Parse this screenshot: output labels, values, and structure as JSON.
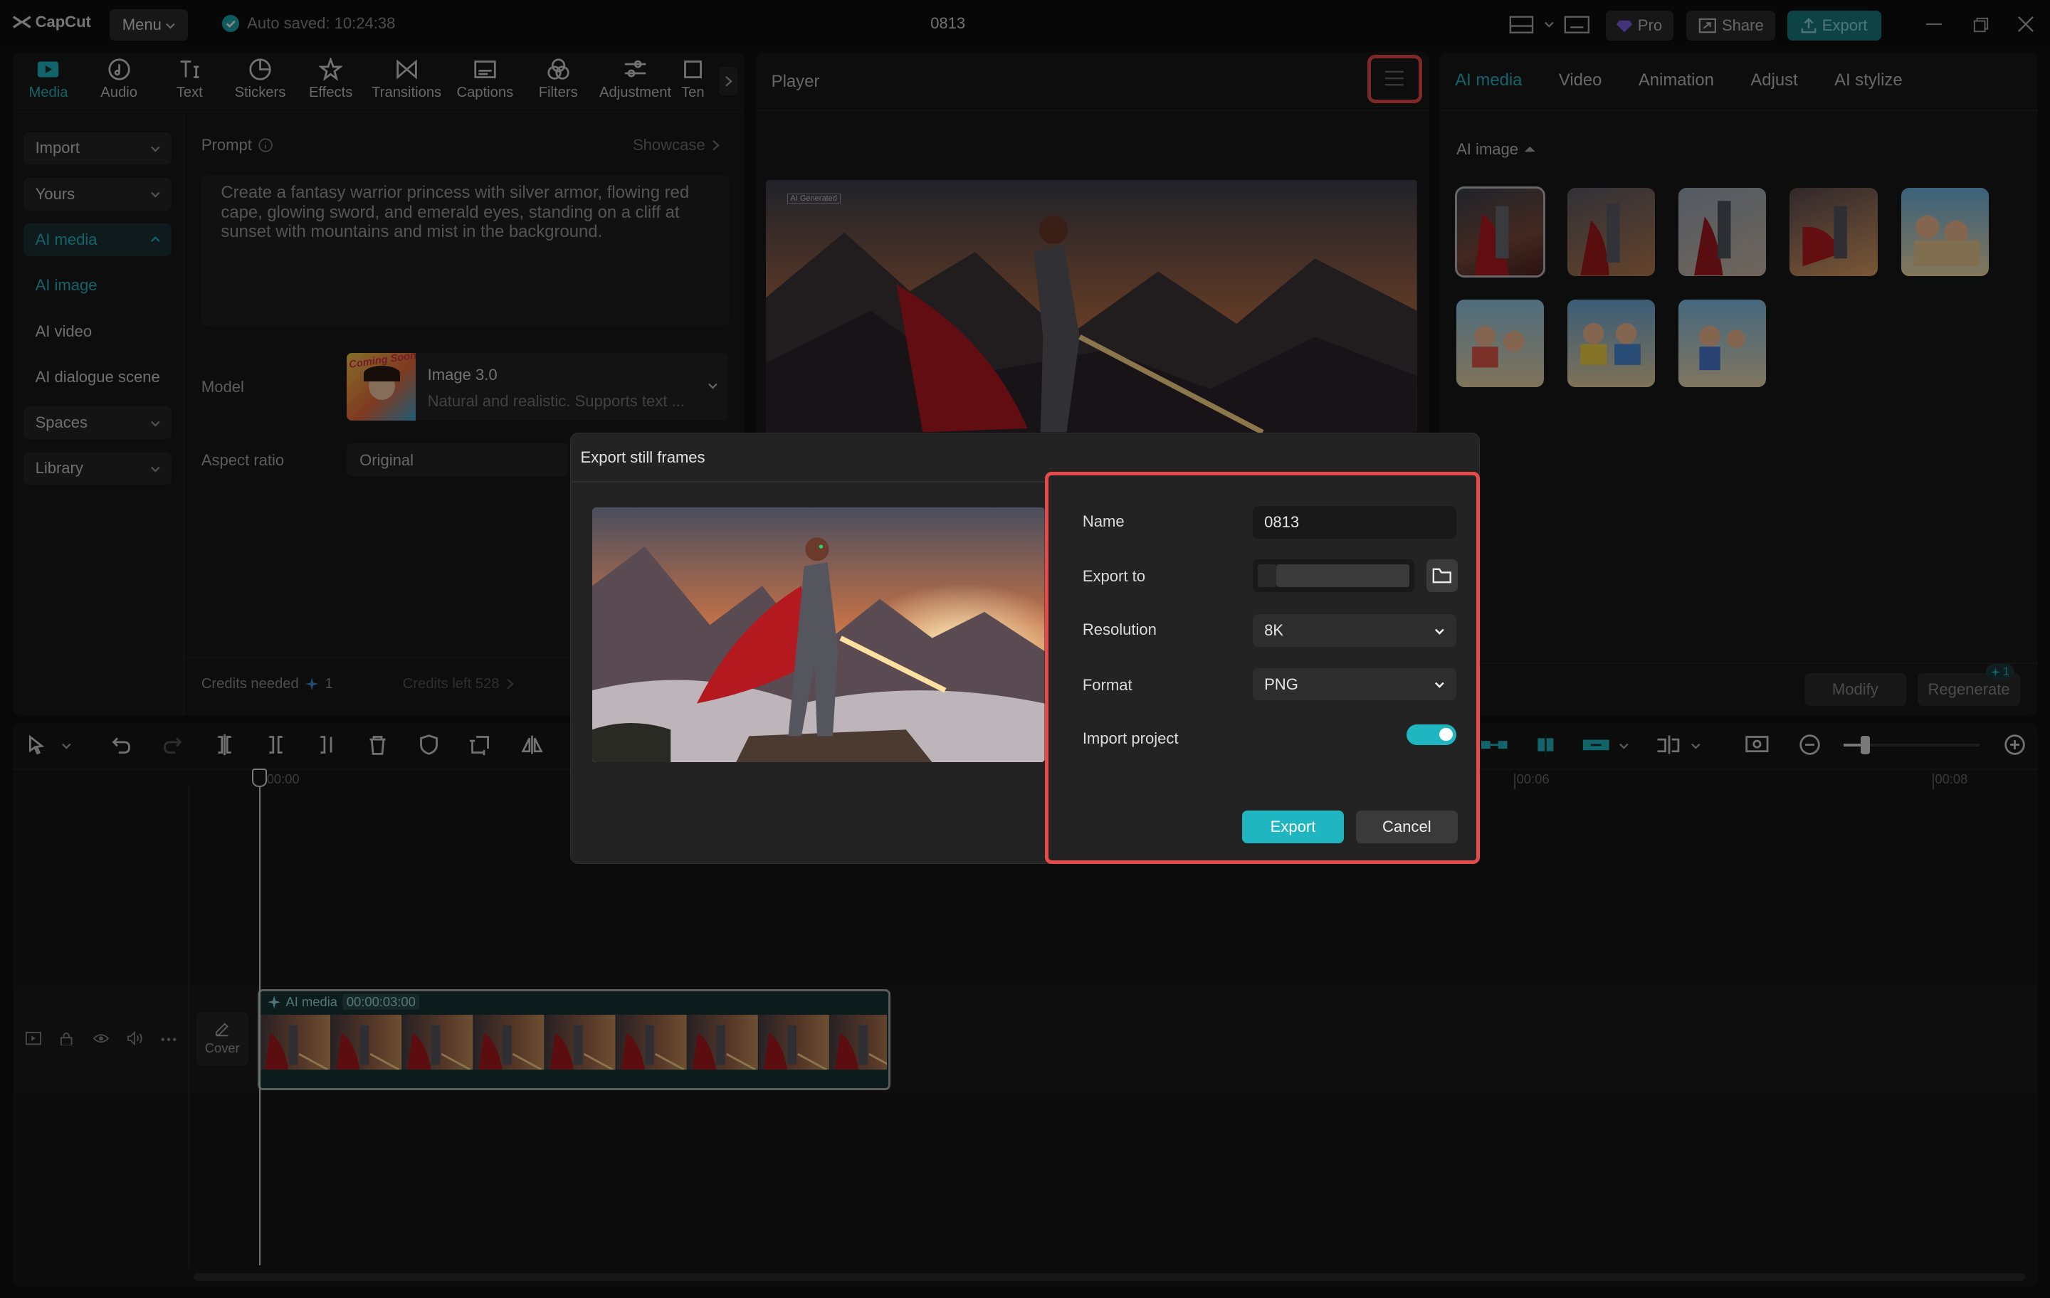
{
  "titlebar": {
    "app_name": "CapCut",
    "menu_label": "Menu",
    "autosave": "Auto saved: 10:24:38",
    "project_name": "0813",
    "pro_label": "Pro",
    "share_label": "Share",
    "export_label": "Export"
  },
  "toolbar": {
    "items": [
      "Media",
      "Audio",
      "Text",
      "Stickers",
      "Effects",
      "Transitions",
      "Captions",
      "Filters",
      "Adjustment",
      "Ten"
    ]
  },
  "sidebar": {
    "items": [
      "Import",
      "Yours",
      "AI media",
      "AI image",
      "AI video",
      "AI dialogue scene",
      "Spaces",
      "Library"
    ]
  },
  "prompt": {
    "label": "Prompt",
    "showcase": "Showcase",
    "text": "Create a fantasy warrior princess with silver armor, flowing red cape, glowing sword, and emerald eyes, standing on a cliff at sunset with mountains and mist in the background."
  },
  "model": {
    "label": "Model",
    "badge": "Coming Soon!",
    "name": "Image 3.0",
    "desc": "Natural and realistic. Supports text ..."
  },
  "aspect": {
    "label": "Aspect ratio",
    "value": "Original"
  },
  "credits": {
    "needed_label": "Credits needed",
    "needed_value": "1",
    "left": "Credits left 528"
  },
  "player": {
    "title": "Player",
    "watermark": "AI Generated"
  },
  "right": {
    "tabs": [
      "AI media",
      "Video",
      "Animation",
      "Adjust",
      "AI stylize"
    ],
    "section": "AI image",
    "modify": "Modify",
    "regenerate": "Regenerate",
    "regen_badge": "1"
  },
  "timeline": {
    "ruler": [
      "00:00",
      "00:06",
      "00:08"
    ],
    "clip_label": "AI media",
    "clip_duration": "00:00:03:00",
    "cover": "Cover"
  },
  "dialog": {
    "title": "Export still frames",
    "name_label": "Name",
    "name_value": "0813",
    "export_to_label": "Export to",
    "resolution_label": "Resolution",
    "resolution_value": "8K",
    "format_label": "Format",
    "format_value": "PNG",
    "import_label": "Import project",
    "import_on": true,
    "export_btn": "Export",
    "cancel_btn": "Cancel"
  },
  "colors": {
    "accent": "#1fb6c1",
    "highlight": "#e64a4a",
    "bg": "#101010",
    "panel": "#181818"
  }
}
